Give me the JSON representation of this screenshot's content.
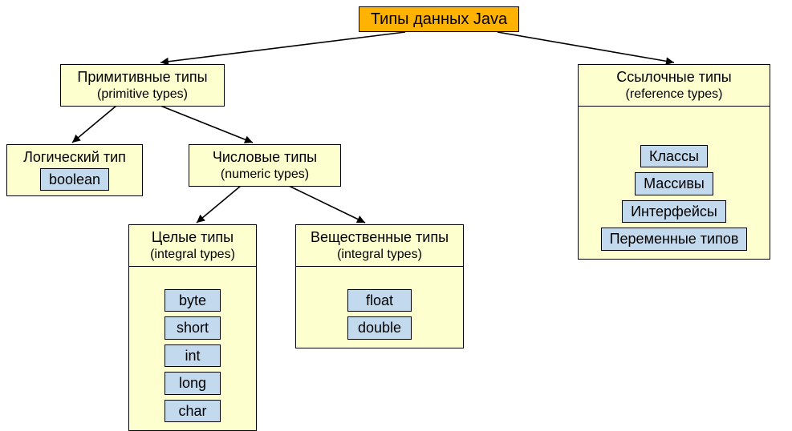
{
  "root": {
    "title": "Типы данных Java"
  },
  "primitive": {
    "title": "Примитивные типы",
    "subtitle": "(primitive types)"
  },
  "reference": {
    "title": "Ссылочные типы",
    "subtitle": "(reference types)",
    "items": [
      "Классы",
      "Массивы",
      "Интерфейсы",
      "Переменные типов"
    ]
  },
  "logical": {
    "title": "Логический тип",
    "items": [
      "boolean"
    ]
  },
  "numeric": {
    "title": "Числовые типы",
    "subtitle": "(numeric types)"
  },
  "integral": {
    "title": "Целые типы",
    "subtitle": "(integral types)",
    "items": [
      "byte",
      "short",
      "int",
      "long",
      "char"
    ]
  },
  "floating": {
    "title": "Вещественные типы",
    "subtitle": "(integral types)",
    "items": [
      "float",
      "double"
    ]
  },
  "chart_data": {
    "type": "tree",
    "title": "Типы данных Java",
    "root": "Типы данных Java",
    "children": [
      {
        "label": "Примитивные типы",
        "sublabel": "(primitive types)",
        "children": [
          {
            "label": "Логический тип",
            "leaves": [
              "boolean"
            ]
          },
          {
            "label": "Числовые типы",
            "sublabel": "(numeric types)",
            "children": [
              {
                "label": "Целые типы",
                "sublabel": "(integral types)",
                "leaves": [
                  "byte",
                  "short",
                  "int",
                  "long",
                  "char"
                ]
              },
              {
                "label": "Вещественные типы",
                "sublabel": "(integral types)",
                "leaves": [
                  "float",
                  "double"
                ]
              }
            ]
          }
        ]
      },
      {
        "label": "Ссылочные типы",
        "sublabel": "(reference types)",
        "leaves": [
          "Классы",
          "Массивы",
          "Интерфейсы",
          "Переменные типов"
        ]
      }
    ]
  }
}
